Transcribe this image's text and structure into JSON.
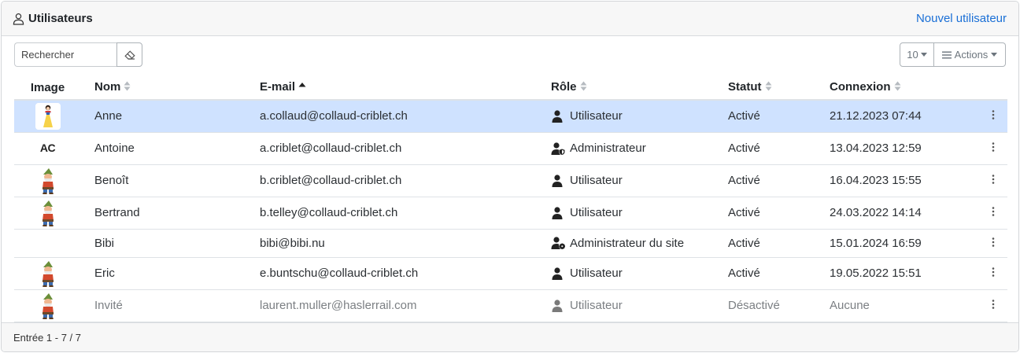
{
  "header": {
    "title": "Utilisateurs",
    "new_user_label": "Nouvel utilisateur"
  },
  "toolbar": {
    "search_placeholder": "Rechercher",
    "page_size": "10",
    "actions_label": "Actions"
  },
  "table": {
    "columns": {
      "image": "Image",
      "name": "Nom",
      "email": "E-mail",
      "role": "Rôle",
      "status": "Statut",
      "login": "Connexion"
    },
    "sorted_by": "email",
    "sort_direction": "asc",
    "rows": [
      {
        "avatar": "snow-white-avatar",
        "name": "Anne",
        "email": "a.collaud@collaud-criblet.ch",
        "role": "Utilisateur",
        "role_icon": "user-icon",
        "status": "Activé",
        "login": "21.12.2023 07:44",
        "selected": true
      },
      {
        "avatar": "initials-avatar",
        "initials": "AC",
        "name": "Antoine",
        "email": "a.criblet@collaud-criblet.ch",
        "role": "Administrateur",
        "role_icon": "user-shield-icon",
        "status": "Activé",
        "login": "13.04.2023 12:59"
      },
      {
        "avatar": "dwarf-avatar",
        "name": "Benoît",
        "email": "b.criblet@collaud-criblet.ch",
        "role": "Utilisateur",
        "role_icon": "user-icon",
        "status": "Activé",
        "login": "16.04.2023 15:55"
      },
      {
        "avatar": "dwarf-avatar",
        "name": "Bertrand",
        "email": "b.telley@collaud-criblet.ch",
        "role": "Utilisateur",
        "role_icon": "user-icon",
        "status": "Activé",
        "login": "24.03.2022 14:14"
      },
      {
        "avatar": "none",
        "name": "Bibi",
        "email": "bibi@bibi.nu",
        "role": "Administrateur du site",
        "role_icon": "user-gear-icon",
        "status": "Activé",
        "login": "15.01.2024 16:59"
      },
      {
        "avatar": "dwarf-avatar",
        "name": "Eric",
        "email": "e.buntschu@collaud-criblet.ch",
        "role": "Utilisateur",
        "role_icon": "user-icon",
        "status": "Activé",
        "login": "19.05.2022 15:51"
      },
      {
        "avatar": "dwarf-avatar",
        "name": "Invité",
        "email": "laurent.muller@haslerrail.com",
        "role": "Utilisateur",
        "role_icon": "user-icon",
        "status": "Désactivé",
        "login": "Aucune",
        "disabled": true
      }
    ]
  },
  "footer": {
    "entries_text": "Entrée 1 - 7 / 7"
  },
  "colors": {
    "link": "#1a6fd6",
    "selected_row": "#cfe2ff",
    "header_bg": "#f7f7f7"
  }
}
